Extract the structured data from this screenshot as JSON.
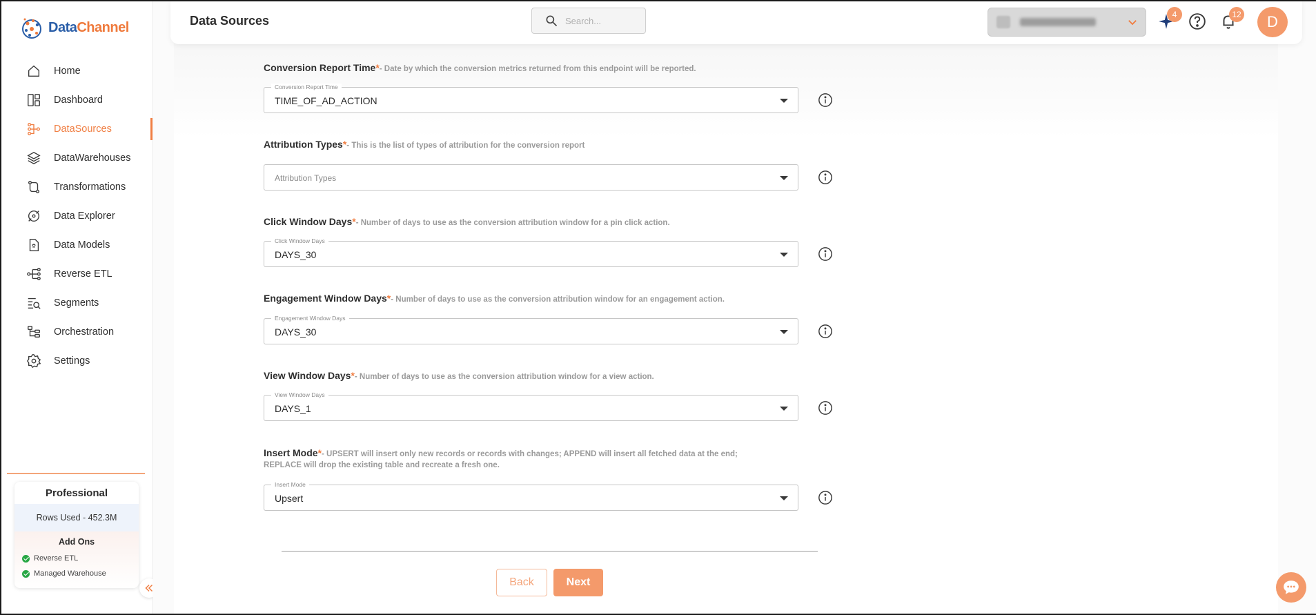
{
  "brand": {
    "name_part1": "Data",
    "name_part2": "Channel"
  },
  "header": {
    "title": "Data Sources",
    "search_placeholder": "Search...",
    "sparkle_badge": "4",
    "notifications_badge": "12",
    "avatar_initial": "D"
  },
  "nav": {
    "items": [
      {
        "label": "Home"
      },
      {
        "label": "Dashboard"
      },
      {
        "label": "DataSources"
      },
      {
        "label": "DataWarehouses"
      },
      {
        "label": "Transformations"
      },
      {
        "label": "Data Explorer"
      },
      {
        "label": "Data Models"
      },
      {
        "label": "Reverse ETL"
      },
      {
        "label": "Segments"
      },
      {
        "label": "Orchestration"
      },
      {
        "label": "Settings"
      }
    ],
    "active": "DataSources"
  },
  "plan": {
    "title": "Professional",
    "rows_used": "Rows Used - 452.3M",
    "addons_title": "Add Ons",
    "addons": [
      "Reverse ETL",
      "Managed Warehouse"
    ]
  },
  "form": {
    "required_mark": "*",
    "fields": [
      {
        "label": "Conversion Report Time",
        "hint": "- Date by which the conversion metrics returned from this endpoint will be reported.",
        "floating": "Conversion Report Time",
        "value": "TIME_OF_AD_ACTION",
        "placeholder": ""
      },
      {
        "label": "Attribution Types",
        "hint": "- This is the list of types of attribution for the conversion report",
        "floating": "",
        "value": "",
        "placeholder": "Attribution Types"
      },
      {
        "label": "Click Window Days",
        "hint": "- Number of days to use as the conversion attribution window for a pin click action.",
        "floating": "Click Window Days",
        "value": "DAYS_30",
        "placeholder": ""
      },
      {
        "label": "Engagement Window Days",
        "hint": "- Number of days to use as the conversion attribution window for an engagement action.",
        "floating": "Engagement Window Days",
        "value": "DAYS_30",
        "placeholder": ""
      },
      {
        "label": "View Window Days",
        "hint": "- Number of days to use as the conversion attribution window for a view action.",
        "floating": "View Window Days",
        "value": "DAYS_1",
        "placeholder": ""
      },
      {
        "label": "Insert Mode",
        "hint": "- UPSERT will insert only new records or records with changes; APPEND will insert all fetched data at the end;",
        "hint_line2": "REPLACE will drop the existing table and recreate a fresh one.",
        "floating": "Insert Mode",
        "value": "Upsert",
        "placeholder": ""
      }
    ],
    "back_label": "Back",
    "next_label": "Next"
  },
  "colors": {
    "accent": "#f07e42",
    "accent_soft": "#f49a6b",
    "brand_blue": "#2a5ea8",
    "success": "#27a744"
  }
}
